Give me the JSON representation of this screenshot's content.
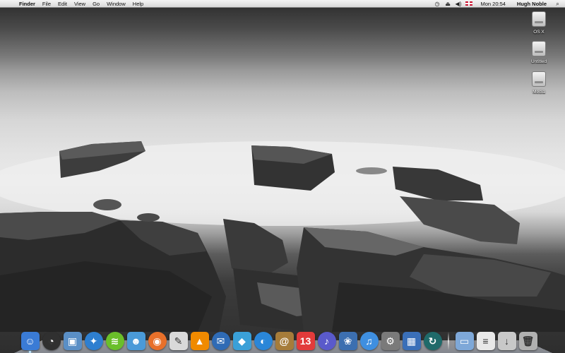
{
  "menubar": {
    "apple_glyph": "",
    "app_name": "Finder",
    "menus": [
      "File",
      "Edit",
      "View",
      "Go",
      "Window",
      "Help"
    ],
    "status_icons": [
      "time-machine-icon",
      "eject-icon",
      "volume-icon",
      "flag-icon"
    ],
    "clock": "Mon 20:54",
    "user": "Hugh Noble",
    "spotlight_glyph": "⌕"
  },
  "desktop": {
    "disks": [
      {
        "label": "OS X"
      },
      {
        "label": "Untitled"
      },
      {
        "label": "Media"
      }
    ]
  },
  "dock": {
    "apps": [
      {
        "name": "finder-icon",
        "glyph": "☺",
        "color": "#3a7bd5",
        "running": true
      },
      {
        "name": "dashboard-icon",
        "glyph": "◔",
        "color": "#303030",
        "round": true
      },
      {
        "name": "preview-icon",
        "glyph": "▣",
        "color": "#5a8fc6"
      },
      {
        "name": "safari-icon",
        "glyph": "✦",
        "color": "#2e7fd0",
        "round": true
      },
      {
        "name": "spotify-icon",
        "glyph": "≋",
        "color": "#6abf2a",
        "round": true
      },
      {
        "name": "ichat-icon",
        "glyph": "☻",
        "color": "#4a9ad8"
      },
      {
        "name": "firefox-icon",
        "glyph": "◉",
        "color": "#e8702a",
        "round": true
      },
      {
        "name": "textedit-icon",
        "glyph": "✎",
        "color": "#d9d9d9"
      },
      {
        "name": "vlc-icon",
        "glyph": "▲",
        "color": "#f08a00"
      },
      {
        "name": "thunderbird-icon",
        "glyph": "✉",
        "color": "#2f6bb5",
        "round": true
      },
      {
        "name": "fish-app-icon",
        "glyph": "◆",
        "color": "#3aa0d8"
      },
      {
        "name": "ichat-video-icon",
        "glyph": "◐",
        "color": "#2a86d8",
        "round": true
      },
      {
        "name": "address-book-icon",
        "glyph": "@",
        "color": "#a67c3a"
      },
      {
        "name": "ical-icon",
        "glyph": "13",
        "color": "#e23b3b"
      },
      {
        "name": "itunes-icon",
        "glyph": "♪",
        "color": "#5a5acb",
        "round": true
      },
      {
        "name": "iphoto-icon",
        "glyph": "❀",
        "color": "#3c6fb0"
      },
      {
        "name": "itunes-music-icon",
        "glyph": "♫",
        "color": "#3f8fe0",
        "round": true
      },
      {
        "name": "system-preferences-icon",
        "glyph": "⚙",
        "color": "#7a7a7a"
      },
      {
        "name": "spaces-icon",
        "glyph": "▦",
        "color": "#3a6fb8"
      },
      {
        "name": "time-machine-icon",
        "glyph": "↻",
        "color": "#1f6a6a",
        "round": true
      }
    ],
    "folders": [
      {
        "name": "applications-folder-icon",
        "glyph": "▭",
        "color": "#7ea8d8"
      },
      {
        "name": "documents-stack-icon",
        "glyph": "≡",
        "color": "#e8e8e8"
      },
      {
        "name": "downloads-stack-icon",
        "glyph": "↓",
        "color": "#c8c8c8"
      },
      {
        "name": "trash-icon",
        "glyph": "🗑",
        "color": "#b0b0b0"
      }
    ]
  }
}
